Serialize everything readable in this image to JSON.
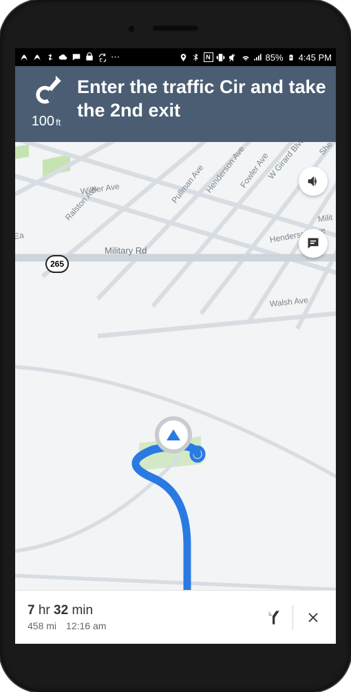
{
  "status": {
    "battery_pct": "85%",
    "time": "4:45 PM"
  },
  "direction": {
    "distance_value": "100",
    "distance_unit": "ft",
    "instruction": "Enter the traffic Cir and take the 2nd exit"
  },
  "map": {
    "streets": {
      "wilber": "Wilber Ave",
      "ralston": "Ralston Ave",
      "pullman": "Pullman Ave",
      "henderson1": "Henderson Ave",
      "henderson2": "Henderson Ave",
      "fowler": "Fowler Ave",
      "girard": "W Girard Blvd",
      "military": "Military Rd",
      "walsh": "Walsh Ave",
      "sheridan": "She",
      "milit_frag": "Milit",
      "east_frag": "Ea"
    },
    "route_shield": "265"
  },
  "trip": {
    "hours": "7",
    "hours_label": "hr",
    "minutes": "32",
    "minutes_label": "min",
    "distance": "458 mi",
    "arrival": "12:16 am"
  }
}
